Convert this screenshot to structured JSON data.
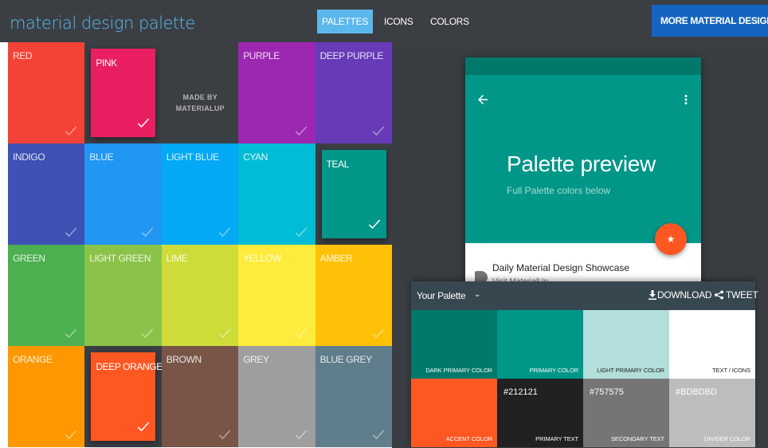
{
  "app": {
    "title": "material design palette",
    "nav": [
      {
        "label": "PALETTES",
        "active": true
      },
      {
        "label": "ICONS",
        "active": false
      },
      {
        "label": "COLORS",
        "active": false
      }
    ],
    "more_button": "MORE MATERIAL DESIGN ›"
  },
  "colors": {
    "topbar": "#3b3f44",
    "brand": "#5bb8ec",
    "active_tab": "#5bb8ec",
    "more_button": "#1565c0",
    "background": "#3a3e43"
  },
  "palette_grid": {
    "made_by_text": "MADE BY\nMATERIALUP",
    "tiles": [
      {
        "label": "RED",
        "color": "#f44336",
        "selected": false,
        "checked": true
      },
      {
        "label": "PINK",
        "color": "#e91e63",
        "selected": true,
        "checked": true
      },
      {
        "label": "",
        "color": "#3b3f44",
        "selected": false,
        "checked": false,
        "made_by": true
      },
      {
        "label": "PURPLE",
        "color": "#9c27b0",
        "selected": false,
        "checked": true
      },
      {
        "label": "DEEP PURPLE",
        "color": "#673ab7",
        "selected": false,
        "checked": true
      },
      {
        "label": "INDIGO",
        "color": "#3f51b5",
        "selected": false,
        "checked": true
      },
      {
        "label": "BLUE",
        "color": "#2196f3",
        "selected": false,
        "checked": true
      },
      {
        "label": "LIGHT BLUE",
        "color": "#03a9f4",
        "selected": false,
        "checked": true
      },
      {
        "label": "CYAN",
        "color": "#00bcd4",
        "selected": false,
        "checked": true
      },
      {
        "label": "TEAL",
        "color": "#009688",
        "selected": true,
        "checked": true
      },
      {
        "label": "GREEN",
        "color": "#4caf50",
        "selected": false,
        "checked": true
      },
      {
        "label": "LIGHT GREEN",
        "color": "#8bc34a",
        "selected": false,
        "checked": true
      },
      {
        "label": "LIME",
        "color": "#cddc39",
        "selected": false,
        "checked": true
      },
      {
        "label": "YELLOW",
        "color": "#ffeb3b",
        "selected": false,
        "checked": true
      },
      {
        "label": "AMBER",
        "color": "#ffc107",
        "selected": false,
        "checked": true
      },
      {
        "label": "ORANGE",
        "color": "#ff9800",
        "selected": false,
        "checked": true
      },
      {
        "label": "DEEP ORANGE",
        "color": "#ff5722",
        "selected": true,
        "checked": true
      },
      {
        "label": "BROWN",
        "color": "#795548",
        "selected": false,
        "checked": true
      },
      {
        "label": "GREY",
        "color": "#9e9e9e",
        "selected": false,
        "checked": true
      },
      {
        "label": "BLUE GREY",
        "color": "#607d8b",
        "selected": false,
        "checked": true
      }
    ]
  },
  "preview": {
    "title": "Palette preview",
    "subtitle": "Full Palette colors below",
    "back_icon": "arrow-back-icon",
    "more_icon": "more-vert-icon",
    "fab_icon": "★",
    "list_title": "Daily Material Design Showcase",
    "list_subtitle": "Visit MaterialUp",
    "status_color": "#00796b",
    "header_color": "#009688",
    "fab_color": "#ff5722"
  },
  "your_palette": {
    "title": "Your Palette",
    "caret": "⌄",
    "download": "DOWNLOAD",
    "tweet": "TWEET",
    "header_color": "#37474f",
    "swatches": [
      {
        "name": "DARK PRIMARY COLOR",
        "hex": "",
        "bg": "#00796b",
        "fg": "#ffffff"
      },
      {
        "name": "PRIMARY COLOR",
        "hex": "",
        "bg": "#009688",
        "fg": "#ffffff"
      },
      {
        "name": "LIGHT PRIMARY COLOR",
        "hex": "",
        "bg": "#b2dfdb",
        "fg": "#212121"
      },
      {
        "name": "TEXT / ICONS",
        "hex": "",
        "bg": "#ffffff",
        "fg": "#212121"
      },
      {
        "name": "ACCENT COLOR",
        "hex": "",
        "bg": "#ff5722",
        "fg": "#ffffff"
      },
      {
        "name": "PRIMARY TEXT",
        "hex": "#212121",
        "bg": "#212121",
        "fg": "#ffffff"
      },
      {
        "name": "SECONDARY TEXT",
        "hex": "#757575",
        "bg": "#757575",
        "fg": "#ffffff"
      },
      {
        "name": "DIVIDER COLOR",
        "hex": "#BDBDBD",
        "bg": "#bdbdbd",
        "fg": "#ffffff"
      }
    ]
  }
}
